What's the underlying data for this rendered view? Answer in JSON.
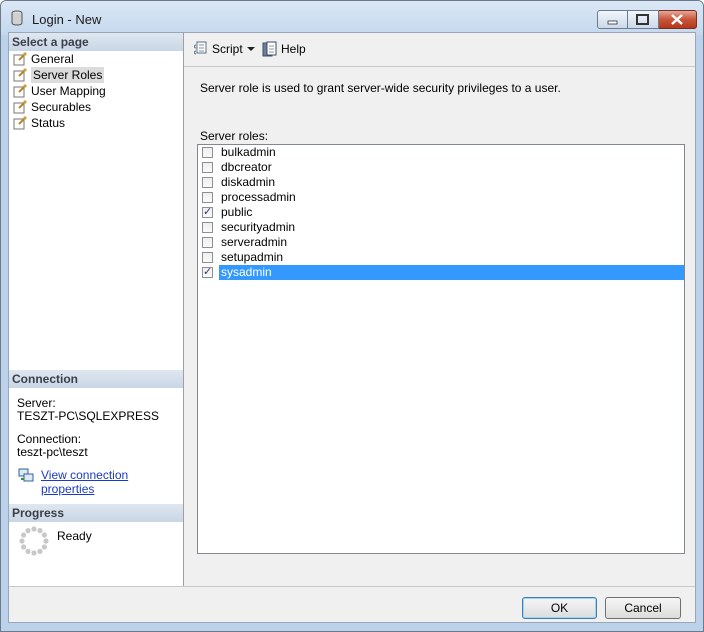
{
  "window": {
    "title": "Login - New"
  },
  "left_panel": {
    "select_page_header": "Select a page",
    "pages": [
      {
        "label": "General",
        "selected": false
      },
      {
        "label": "Server Roles",
        "selected": true
      },
      {
        "label": "User Mapping",
        "selected": false
      },
      {
        "label": "Securables",
        "selected": false
      },
      {
        "label": "Status",
        "selected": false
      }
    ],
    "connection_header": "Connection",
    "server_label": "Server:",
    "server_value": "TESZT-PC\\SQLEXPRESS",
    "connection_label": "Connection:",
    "connection_value": "teszt-pc\\teszt",
    "view_props_link": "View connection properties",
    "progress_header": "Progress",
    "progress_status": "Ready"
  },
  "toolbar": {
    "script_label": "Script",
    "help_label": "Help"
  },
  "main": {
    "description": "Server role is used to grant server-wide security privileges to a user.",
    "roles_label": "Server roles:",
    "roles": [
      {
        "name": "bulkadmin",
        "checked": false,
        "selected": false
      },
      {
        "name": "dbcreator",
        "checked": false,
        "selected": false
      },
      {
        "name": "diskadmin",
        "checked": false,
        "selected": false
      },
      {
        "name": "processadmin",
        "checked": false,
        "selected": false
      },
      {
        "name": "public",
        "checked": true,
        "selected": false
      },
      {
        "name": "securityadmin",
        "checked": false,
        "selected": false
      },
      {
        "name": "serveradmin",
        "checked": false,
        "selected": false
      },
      {
        "name": "setupadmin",
        "checked": false,
        "selected": false
      },
      {
        "name": "sysadmin",
        "checked": true,
        "selected": true
      }
    ]
  },
  "buttons": {
    "ok": "OK",
    "cancel": "Cancel"
  }
}
